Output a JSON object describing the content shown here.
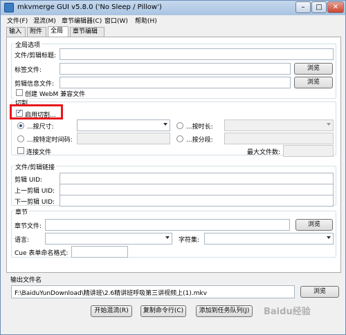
{
  "window": {
    "title": "mkvmerge GUI v5.8.0 ('No Sleep / Pillow')"
  },
  "titlebar_buttons": {
    "minimize": "–",
    "maximize": "□",
    "close": "✕"
  },
  "menu": [
    "文件(F)",
    "混流(M)",
    "章节编辑器(C)",
    "窗口(W)",
    "帮助(H)"
  ],
  "tabs": [
    "输入",
    "附件",
    "全局",
    "章节编辑器"
  ],
  "global_options": {
    "title": "全局选项",
    "file_title_label": "文件/剪辑标题:",
    "tags_label": "标签文件:",
    "segment_info_label": "剪辑信息文件:",
    "browse": "浏览",
    "webm_label": "创建 WebM 兼容文件"
  },
  "splitting": {
    "title": "切割",
    "enable_label": "启用切割...",
    "by_size_label": "...按尺寸:",
    "by_duration_label": "...按时长:",
    "by_timecodes_label": "...按特定时间码:",
    "by_parts_label": "...按分段:",
    "link_label": "连接文件",
    "max_files_label": "最大文件数:"
  },
  "linking": {
    "title": "文件/剪辑链接",
    "segment_uid": "剪辑 UID:",
    "prev_uid": "上一剪辑 UID:",
    "next_uid": "下一剪辑 UID:"
  },
  "chapters": {
    "title": "章节",
    "file_label": "章节文件:",
    "browse": "浏览",
    "language_label": "语言:",
    "charset_label": "字符集:",
    "cue_label": "Cue 表单命名格式:"
  },
  "output": {
    "title": "输出文件名",
    "path": "F:\\BaiduYunDownload\\精讲班\\2.6精讲班呼吸第三讲视频上(1).mkv",
    "browse": "浏览"
  },
  "actions": {
    "start": "开始混流(R)",
    "copy": "复制命令行(C)",
    "queue": "添加到任务队列(J)"
  },
  "watermark": "Baidu经验"
}
